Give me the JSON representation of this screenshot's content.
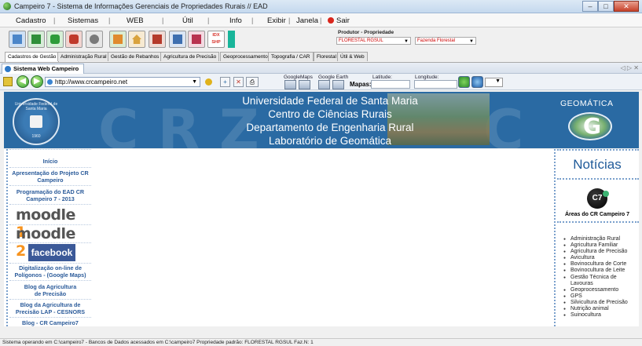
{
  "window": {
    "title": "Campeiro 7 - Sistema de Informações Gerenciais de Propriedades Rurais // EAD",
    "controls": [
      "–",
      "□",
      "✕"
    ]
  },
  "menu": {
    "items": [
      "Cadastro",
      "Sistemas",
      "WEB",
      "Útil",
      "Info",
      "Exibir",
      "Janela",
      "Sair"
    ],
    "separator": "|"
  },
  "toolbar": {
    "icons": [
      {
        "name": "grid",
        "color": "#4c86c9"
      },
      {
        "name": "tractor",
        "color": "#2f8f3a"
      },
      {
        "name": "map-green",
        "color": "#2d9c39"
      },
      {
        "name": "map-red",
        "color": "#c0392b"
      },
      {
        "name": "gear",
        "color": "#7a7a7a"
      },
      {
        "name": "plant",
        "color": "#e08b2d"
      },
      {
        "name": "house",
        "color": "#d9a23d"
      },
      {
        "name": "harvest",
        "color": "#b53a2b"
      },
      {
        "name": "chart",
        "color": "#3e6fb0"
      },
      {
        "name": "photo",
        "color": "#b8324f"
      },
      {
        "name": "idx-shp",
        "color": "#d6322a"
      },
      {
        "name": "teal-marker",
        "color": "#18b59a"
      }
    ],
    "idx_label": "IDX",
    "shp_label": "SHP",
    "producer_label": "Produtor - Propriedade",
    "producer_value": "FLORESTAL RGSUL",
    "property_value": "Fazenda Florestal"
  },
  "tabs": [
    "Cadastros de Gestão",
    "Administração Rural",
    "Gestão de Rebanhos",
    "Agricultura de Precisão",
    "Geoprocessamento",
    "Topografia / CAR",
    "Florestal",
    "Útil & Web"
  ],
  "active_tab_index": 0,
  "browser": {
    "tab_title": "Sistema Web Campeiro 7",
    "tab_nav": "◁ ▷ ✕",
    "url": "http://www.crcampeiro.net",
    "googlemaps_label": "GoogleMaps",
    "googleearth_label": "Google Earth",
    "mapas_label": "Mapas:",
    "latitude_label": "Latitude:",
    "longitude_label": "Longitude:"
  },
  "banner": {
    "bg_letters": [
      "C R Z",
      "C"
    ],
    "lines": [
      "Universidade Federal de Santa Maria",
      "Centro de Ciências Rurais",
      "Departamento de Engenharia Rural",
      "Laboratório de Geomática"
    ],
    "seal_text": "Universidade Federal de Santa Maria",
    "seal_year": "1960",
    "geo_title": "GEOMÁTICA",
    "geo_letter": "G"
  },
  "left_menu": {
    "links": [
      "Início",
      "Apresentação do Projeto CR Campeiro",
      "Programação do EAD CR Campeiro 7 - 2013",
      "Digitalização on-line de Polígonos - (Google Maps)",
      "Blog da Agricultura de Precisão",
      "Blog da Agricultura de Precisão LAP - CESNORS",
      "Blog - CR Campeiro7"
    ],
    "moodle1": "moodle",
    "moodle1_num": "1",
    "moodle2": "moodle",
    "moodle2_num": "2",
    "facebook": "facebook"
  },
  "right_panel": {
    "title": "Notícias",
    "logo_text": "C7",
    "areas_title": "Áreas do CR Campeiro 7",
    "areas": [
      "Administração Rural",
      "Agricultura Familiar",
      "Agricultura de Precisão",
      "Avicultura",
      "Bovinocultura de Corte",
      "Bovinocultura de Leite",
      "Gestão Técnica de Lavouras",
      "Geoprocessamento",
      "GPS",
      "Silvicultura de Precisão",
      "Nutrição animal",
      "Suinocultura"
    ]
  },
  "status": {
    "text": "Sistema operando em C:\\campeiro7  -  Bancos de Dados acessados em C:\\campeiro7  Propriedade padrão: FLORESTAL RGSUL Faz.N: 1"
  }
}
